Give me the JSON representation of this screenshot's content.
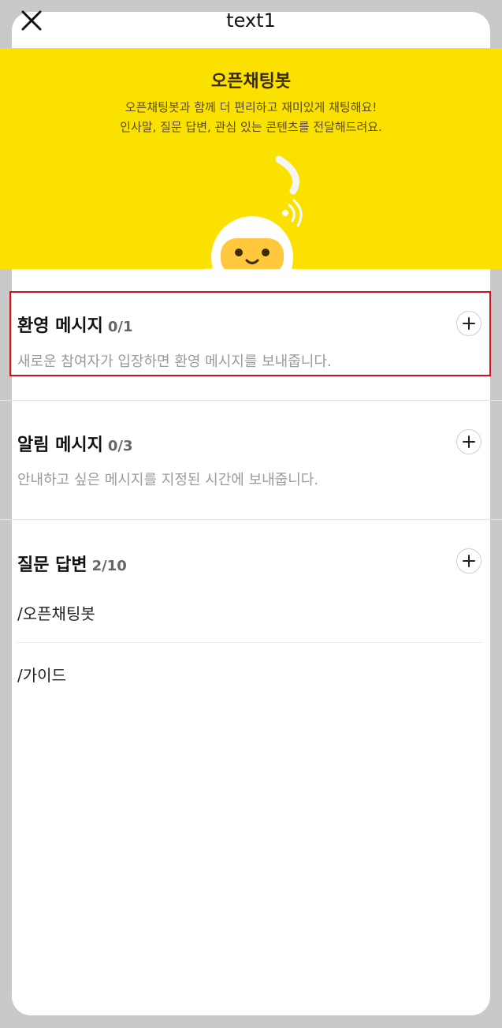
{
  "header": {
    "title": "text1",
    "close_icon": "close-icon"
  },
  "banner": {
    "title": "오픈채팅봇",
    "desc_line1": "오픈채팅봇과 함께 더 편리하고 재미있게 채팅해요!",
    "desc_line2": "인사말, 질문 답변, 관심 있는 콘텐츠를 전달해드려요.",
    "background": "#fae100",
    "illustration": "chatbot-robot-icon"
  },
  "sections": {
    "welcome": {
      "title": "환영 메시지",
      "count": "0/1",
      "desc": "새로운 참여자가 입장하면 환영 메시지를 보내줍니다.",
      "add_icon": "plus-icon",
      "highlight_color": "#d0141a"
    },
    "notice": {
      "title": "알림 메시지",
      "count": "0/3",
      "desc": "안내하고 싶은 메시지를 지정된 시간에 보내줍니다.",
      "add_icon": "plus-icon"
    },
    "qa": {
      "title": "질문 답변",
      "count": "2/10",
      "add_icon": "plus-icon",
      "items": [
        "/오픈채팅봇",
        "/가이드"
      ]
    }
  }
}
